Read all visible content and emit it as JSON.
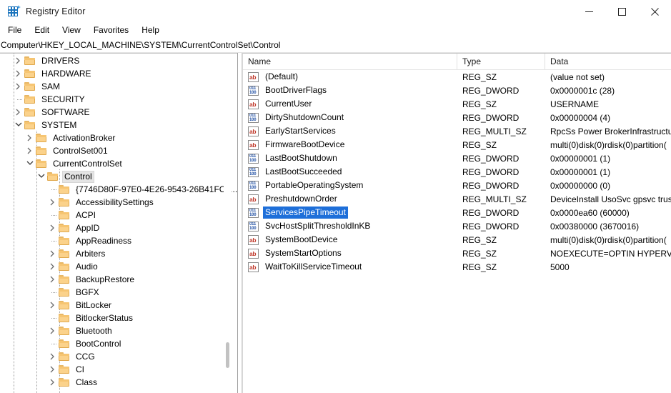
{
  "window": {
    "title": "Registry Editor",
    "app_icon": "registry-grid-icon",
    "minimize_label": "Minimize",
    "maximize_label": "Maximize",
    "close_label": "Close"
  },
  "menu": {
    "items": [
      "File",
      "Edit",
      "View",
      "Favorites",
      "Help"
    ]
  },
  "address": {
    "path": "Computer\\HKEY_LOCAL_MACHINE\\SYSTEM\\CurrentControlSet\\Control"
  },
  "tree": {
    "items": [
      {
        "label": "DRIVERS",
        "depth": 1,
        "expander": "collapsed",
        "selected": false
      },
      {
        "label": "HARDWARE",
        "depth": 1,
        "expander": "collapsed",
        "selected": false
      },
      {
        "label": "SAM",
        "depth": 1,
        "expander": "collapsed",
        "selected": false
      },
      {
        "label": "SECURITY",
        "depth": 1,
        "expander": "none",
        "selected": false
      },
      {
        "label": "SOFTWARE",
        "depth": 1,
        "expander": "collapsed",
        "selected": false
      },
      {
        "label": "SYSTEM",
        "depth": 1,
        "expander": "expanded",
        "selected": false
      },
      {
        "label": "ActivationBroker",
        "depth": 2,
        "expander": "collapsed",
        "selected": false
      },
      {
        "label": "ControlSet001",
        "depth": 2,
        "expander": "collapsed",
        "selected": false
      },
      {
        "label": "CurrentControlSet",
        "depth": 2,
        "expander": "expanded",
        "selected": false
      },
      {
        "label": "Control",
        "depth": 3,
        "expander": "expanded",
        "selected": true
      },
      {
        "label": "{7746D80F-97E0-4E26-9543-26B41FC2...",
        "depth": 4,
        "expander": "none",
        "selected": false
      },
      {
        "label": "AccessibilitySettings",
        "depth": 4,
        "expander": "collapsed",
        "selected": false
      },
      {
        "label": "ACPI",
        "depth": 4,
        "expander": "none",
        "selected": false
      },
      {
        "label": "AppID",
        "depth": 4,
        "expander": "collapsed",
        "selected": false
      },
      {
        "label": "AppReadiness",
        "depth": 4,
        "expander": "none",
        "selected": false
      },
      {
        "label": "Arbiters",
        "depth": 4,
        "expander": "collapsed",
        "selected": false
      },
      {
        "label": "Audio",
        "depth": 4,
        "expander": "collapsed",
        "selected": false
      },
      {
        "label": "BackupRestore",
        "depth": 4,
        "expander": "collapsed",
        "selected": false
      },
      {
        "label": "BGFX",
        "depth": 4,
        "expander": "none",
        "selected": false
      },
      {
        "label": "BitLocker",
        "depth": 4,
        "expander": "collapsed",
        "selected": false
      },
      {
        "label": "BitlockerStatus",
        "depth": 4,
        "expander": "none",
        "selected": false
      },
      {
        "label": "Bluetooth",
        "depth": 4,
        "expander": "collapsed",
        "selected": false
      },
      {
        "label": "BootControl",
        "depth": 4,
        "expander": "none",
        "selected": false
      },
      {
        "label": "CCG",
        "depth": 4,
        "expander": "collapsed",
        "selected": false
      },
      {
        "label": "CI",
        "depth": 4,
        "expander": "collapsed",
        "selected": false
      },
      {
        "label": "Class",
        "depth": 4,
        "expander": "collapsed",
        "selected": false
      }
    ]
  },
  "list": {
    "columns": [
      "Name",
      "Type",
      "Data"
    ],
    "rows": [
      {
        "name": "(Default)",
        "type": "REG_SZ",
        "data": "(value not set)",
        "icon": "string-value-icon",
        "selected": false
      },
      {
        "name": "BootDriverFlags",
        "type": "REG_DWORD",
        "data": "0x0000001c (28)",
        "icon": "dword-value-icon",
        "selected": false
      },
      {
        "name": "CurrentUser",
        "type": "REG_SZ",
        "data": "USERNAME",
        "icon": "string-value-icon",
        "selected": false
      },
      {
        "name": "DirtyShutdownCount",
        "type": "REG_DWORD",
        "data": "0x00000004 (4)",
        "icon": "dword-value-icon",
        "selected": false
      },
      {
        "name": "EarlyStartServices",
        "type": "REG_MULTI_SZ",
        "data": "RpcSs Power BrokerInfrastructu",
        "icon": "string-value-icon",
        "selected": false
      },
      {
        "name": "FirmwareBootDevice",
        "type": "REG_SZ",
        "data": "multi(0)disk(0)rdisk(0)partition(",
        "icon": "string-value-icon",
        "selected": false
      },
      {
        "name": "LastBootShutdown",
        "type": "REG_DWORD",
        "data": "0x00000001 (1)",
        "icon": "dword-value-icon",
        "selected": false
      },
      {
        "name": "LastBootSucceeded",
        "type": "REG_DWORD",
        "data": "0x00000001 (1)",
        "icon": "dword-value-icon",
        "selected": false
      },
      {
        "name": "PortableOperatingSystem",
        "type": "REG_DWORD",
        "data": "0x00000000 (0)",
        "icon": "dword-value-icon",
        "selected": false
      },
      {
        "name": "PreshutdownOrder",
        "type": "REG_MULTI_SZ",
        "data": "DeviceInstall UsoSvc gpsvc trus",
        "icon": "string-value-icon",
        "selected": false
      },
      {
        "name": "ServicesPipeTimeout",
        "type": "REG_DWORD",
        "data": "0x0000ea60 (60000)",
        "icon": "dword-value-icon",
        "selected": true
      },
      {
        "name": "SvcHostSplitThresholdInKB",
        "type": "REG_DWORD",
        "data": "0x00380000 (3670016)",
        "icon": "dword-value-icon",
        "selected": false
      },
      {
        "name": "SystemBootDevice",
        "type": "REG_SZ",
        "data": "multi(0)disk(0)rdisk(0)partition(",
        "icon": "string-value-icon",
        "selected": false
      },
      {
        "name": "SystemStartOptions",
        "type": "REG_SZ",
        "data": " NOEXECUTE=OPTIN  HYPERVI",
        "icon": "string-value-icon",
        "selected": false
      },
      {
        "name": "WaitToKillServiceTimeout",
        "type": "REG_SZ",
        "data": "5000",
        "icon": "string-value-icon",
        "selected": false
      }
    ]
  },
  "colors": {
    "selection_blue": "#1e6fd9",
    "tree_selection_gray": "#e4e4e4",
    "folder_yellow": "#fbd28b",
    "string_icon_red": "#c0392b",
    "dword_icon_blue": "#1f4fa3"
  }
}
